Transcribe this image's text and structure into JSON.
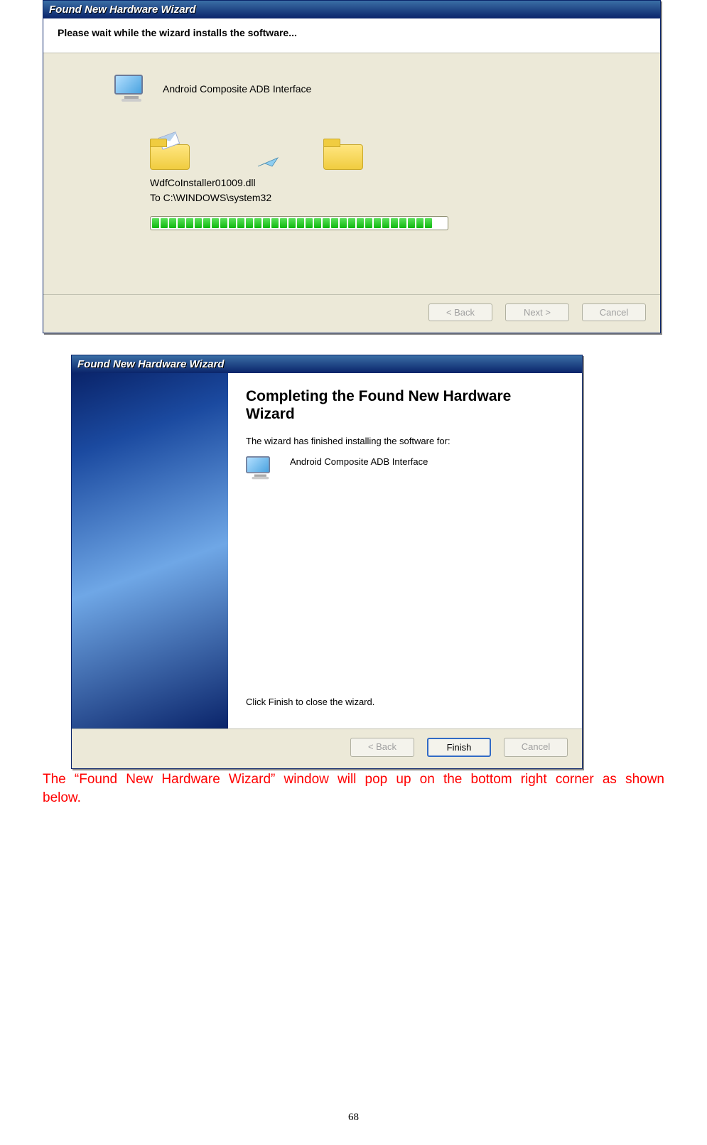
{
  "dialog1": {
    "title": "Found New Hardware Wizard",
    "subheader": "Please wait while the wizard installs the software...",
    "device_name": "Android Composite ADB Interface",
    "filename": "WdfCoInstaller01009.dll",
    "destination": "To C:\\WINDOWS\\system32",
    "buttons": {
      "back": "< Back",
      "next": "Next >",
      "cancel": "Cancel"
    }
  },
  "dialog2": {
    "title": "Found New Hardware Wizard",
    "heading": "Completing the Found New Hardware Wizard",
    "subtext": "The wizard has finished installing the software for:",
    "device_name": "Android Composite ADB Interface",
    "closetext": "Click Finish to close the wizard.",
    "buttons": {
      "back": "< Back",
      "finish": "Finish",
      "cancel": "Cancel"
    }
  },
  "caption": "The “Found New Hardware Wizard” window will pop up on the bottom right corner as shown below.",
  "page_number": "68"
}
